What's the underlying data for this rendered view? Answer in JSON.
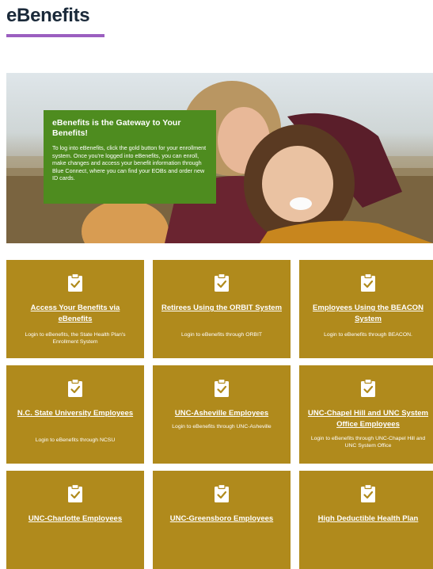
{
  "page": {
    "title": "eBenefits"
  },
  "colors": {
    "accent_rule": "#9b5fc0",
    "hero_card": "#4e8c1f",
    "tile_bg": "#b08a1c",
    "title_text": "#1b2a3a"
  },
  "hero": {
    "heading": "eBenefits is the Gateway to Your Benefits!",
    "body": "To log into eBenefits, click the gold button for your enrollment system. Once you're logged into eBenefits, you can enroll, make changes and access your benefit information through Blue Connect, where you can find your EOBs and order new ID cards.",
    "image": "photo-of-smiling-family-outdoors"
  },
  "tiles": [
    {
      "icon": "clipboard-check-icon",
      "title": "Access Your Benefits via eBenefits",
      "desc": "Login to eBenefits, the State Health Plan's Enrollment System"
    },
    {
      "icon": "clipboard-check-icon",
      "title": "Retirees Using the ORBIT System",
      "desc": "Login to eBenefits through ORBIT"
    },
    {
      "icon": "clipboard-check-icon",
      "title": "Employees Using the BEACON System",
      "desc": "Login to eBenefits through BEACON."
    },
    {
      "icon": "clipboard-check-icon",
      "title": "N.C. State University Employees",
      "desc": "Login to eBenefits through NCSU"
    },
    {
      "icon": "clipboard-check-icon",
      "title": "UNC-Asheville Employees",
      "desc": "Login to eBenefits through UNC-Asheville"
    },
    {
      "icon": "clipboard-check-icon",
      "title": "UNC-Chapel Hill and UNC System Office Employees",
      "desc": "Login to eBenefits through UNC-Chapel Hill and UNC System Office"
    },
    {
      "icon": "clipboard-check-icon",
      "title": "UNC-Charlotte Employees",
      "desc": ""
    },
    {
      "icon": "clipboard-check-icon",
      "title": "UNC-Greensboro Employees",
      "desc": ""
    },
    {
      "icon": "clipboard-check-icon",
      "title": "High Deductible Health Plan",
      "desc": ""
    }
  ]
}
